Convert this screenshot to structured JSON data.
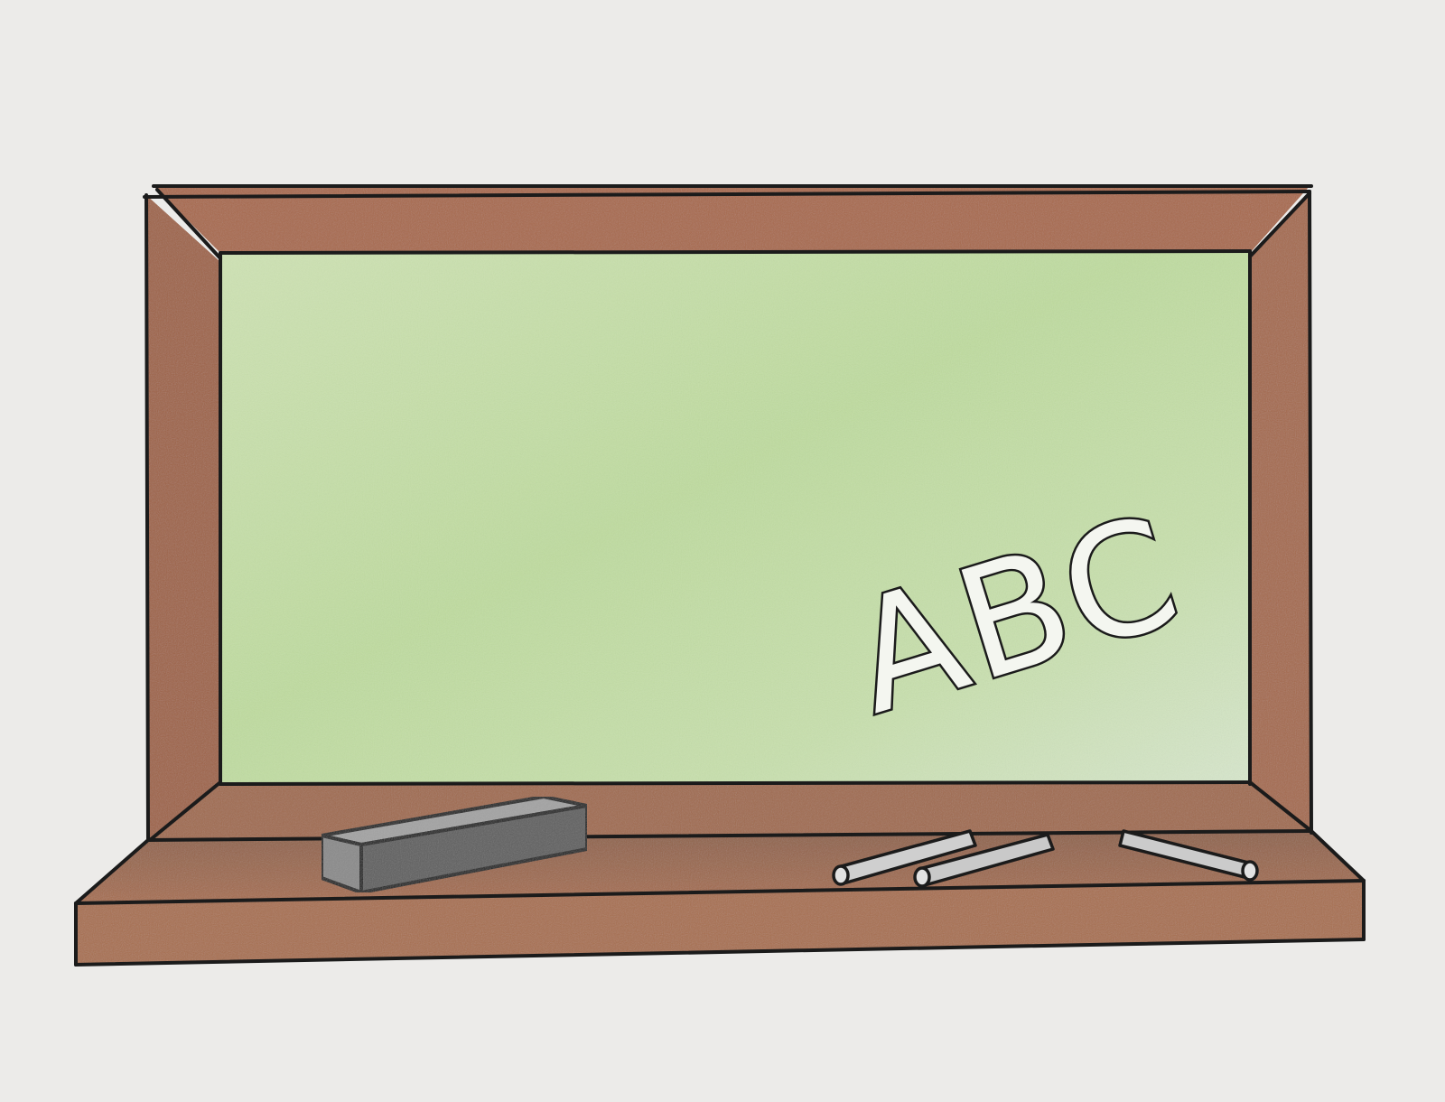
{
  "board": {
    "chalk_text": "ABC"
  },
  "colors": {
    "paper": "#ecebe9",
    "frame": "#a6694a",
    "frame_shadow": "#8c5a40",
    "board": "#c5dea9",
    "board_light": "#dbe8d0",
    "eraser": "#8a8a8a",
    "chalk": "#d8d8d8",
    "outline": "#1b1b1b"
  },
  "objects": {
    "eraser_count": 1,
    "chalk_pieces": 3
  }
}
